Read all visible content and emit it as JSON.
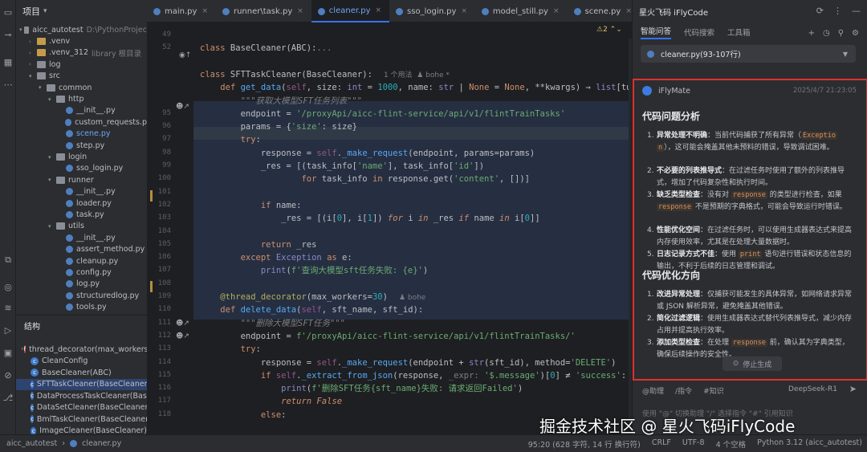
{
  "project": {
    "title": "项目",
    "tree": [
      {
        "label": "aicc_autotest",
        "sub": "D:\\PythonProjec",
        "depth": 0,
        "type": "folder",
        "open": true
      },
      {
        "label": ".venv",
        "depth": 1,
        "type": "folderY",
        "open": false
      },
      {
        "label": ".venv_312",
        "sub": "library 根目录",
        "depth": 1,
        "type": "folderY",
        "open": false
      },
      {
        "label": "log",
        "depth": 1,
        "type": "folder",
        "open": false
      },
      {
        "label": "src",
        "depth": 1,
        "type": "folder",
        "open": true
      },
      {
        "label": "common",
        "depth": 2,
        "type": "folder",
        "open": true
      },
      {
        "label": "http",
        "depth": 3,
        "type": "folder",
        "open": true
      },
      {
        "label": "__init__.py",
        "depth": 4,
        "type": "py"
      },
      {
        "label": "custom_requests.p",
        "depth": 4,
        "type": "py"
      },
      {
        "label": "scene.py",
        "depth": 4,
        "type": "py",
        "blue": true
      },
      {
        "label": "step.py",
        "depth": 4,
        "type": "py"
      },
      {
        "label": "login",
        "depth": 3,
        "type": "folder",
        "open": true
      },
      {
        "label": "sso_login.py",
        "depth": 4,
        "type": "py"
      },
      {
        "label": "runner",
        "depth": 3,
        "type": "folder",
        "open": true
      },
      {
        "label": "__init__.py",
        "depth": 4,
        "type": "py"
      },
      {
        "label": "loader.py",
        "depth": 4,
        "type": "py"
      },
      {
        "label": "task.py",
        "depth": 4,
        "type": "py"
      },
      {
        "label": "utils",
        "depth": 3,
        "type": "folder",
        "open": true
      },
      {
        "label": "__init__.py",
        "depth": 4,
        "type": "py"
      },
      {
        "label": "assert_method.py",
        "depth": 4,
        "type": "py"
      },
      {
        "label": "cleanup.py",
        "depth": 4,
        "type": "py"
      },
      {
        "label": "config.py",
        "depth": 4,
        "type": "py"
      },
      {
        "label": "log.py",
        "depth": 4,
        "type": "py"
      },
      {
        "label": "structuredlog.py",
        "depth": 4,
        "type": "py"
      },
      {
        "label": "tools.py",
        "depth": 4,
        "type": "py"
      }
    ]
  },
  "structure": {
    "title": "结构",
    "items": [
      {
        "label": "thread_decorator(max_workers",
        "kind": "red",
        "expand": true
      },
      {
        "label": "CleanConfig",
        "kind": "blue"
      },
      {
        "label": "BaseCleaner(ABC)",
        "kind": "blue"
      },
      {
        "label": "SFTTaskCleaner(BaseCleaner)",
        "kind": "blue",
        "selected": true
      },
      {
        "label": "DataProcessTaskCleaner(BaseC",
        "kind": "blue"
      },
      {
        "label": "DataSetCleaner(BaseCleaner)",
        "kind": "blue"
      },
      {
        "label": "BmlTaskCleaner(BaseCleaner)",
        "kind": "blue"
      },
      {
        "label": "ImageCleaner(BaseCleaner)",
        "kind": "blue"
      }
    ]
  },
  "tabs": [
    {
      "label": "main.py",
      "active": false
    },
    {
      "label": "runner\\task.py",
      "active": false
    },
    {
      "label": "cleaner.py",
      "active": true
    },
    {
      "label": "sso_login.py",
      "active": false
    },
    {
      "label": "model_still.py",
      "active": false
    },
    {
      "label": "scene.py",
      "active": false
    }
  ],
  "editor": {
    "warnings": "2",
    "lines": [
      {
        "n": "49",
        "html": ""
      },
      {
        "n": "52",
        "html": "<span class='kw'>class</span> BaseCleaner(ABC):<span style='color:#7a7e85'>...</span>"
      },
      {
        "n": "",
        "html": ""
      },
      {
        "n": "",
        "html": "<span class='kw'>class</span> SFTTaskCleaner(BaseCleaner):<span class='hint'>1 个用法  ♟ bohe *</span>"
      },
      {
        "n": "",
        "html": "    <span class='kw'>def</span> <span class='fn'>get_data</span>(<span class='self'>self</span>, size: <span class='builtin'>int</span> = <span class='num'>1000</span>, name: <span class='builtin'>str</span> | <span class='kw'>None</span> = <span class='kw'>None</span>, **kwargs) → <span class='builtin'>list</span>[tuple[Any"
      },
      {
        "n": "",
        "html": "        <span class='cmt'>\"\"\"获取大模型SFT任务列表\"\"\"</span>"
      },
      {
        "n": "95",
        "html": "        endpoint = <span class='str'>'/proxyApi/aicc-flint-service/api/v1/flintTrainTasks'</span>"
      },
      {
        "n": "96",
        "html": "        params = {<span class='str'>'size'</span>: size}"
      },
      {
        "n": "97",
        "html": "        <span class='kw'>try</span>:"
      },
      {
        "n": "98",
        "html": "            response = <span class='self'>self</span>.<span class='fn'>_make_request</span>(endpoint, params=params)"
      },
      {
        "n": "99",
        "html": "            _res = [(task_info[<span class='str'>'name'</span>], task_info[<span class='str'>'id'</span>])"
      },
      {
        "n": "100",
        "html": "                    <span class='kw'>for</span> task_info <span class='kw'>in</span> response.get(<span class='str'>'content'</span>, [])]"
      },
      {
        "n": "101",
        "html": ""
      },
      {
        "n": "102",
        "html": "            <span class='kw'>if</span> name:"
      },
      {
        "n": "103",
        "html": "                _res = [(i[<span class='num'>0</span>], i[<span class='num'>1</span>]) <span class='kw ital'>for</span> i <span class='kw ital'>in</span> _res <span class='kw ital'>if</span> name <span class='kw ital'>in</span> i[<span class='num'>0</span>]]"
      },
      {
        "n": "104",
        "html": ""
      },
      {
        "n": "105",
        "html": "            <span class='kw'>return</span> _res"
      },
      {
        "n": "106",
        "html": "        <span class='kw'>except</span> <span class='builtin'>Exception</span> <span class='kw'>as</span> e:"
      },
      {
        "n": "107",
        "html": "            <span class='builtin'>print</span>(<span class='str'>f'查询大模型sft任务失败: {e}'</span>)"
      },
      {
        "n": "108",
        "html": ""
      },
      {
        "n": "109",
        "html": "    <span class='dec'>@thread_decorator</span>(max_workers=<span class='num'>30</span>)<span class='hint'>♟ bohe</span>"
      },
      {
        "n": "110",
        "html": "    <span class='kw'>def</span> <span class='fn'>delete_data</span>(<span class='self'>self</span>, sft_name, sft_id):"
      },
      {
        "n": "111",
        "html": "        <span class='cmt'>\"\"\"删除大模型SFT任务\"\"\"</span>"
      },
      {
        "n": "112",
        "html": "        endpoint = <span class='str'>f'/proxyApi/aicc-flint-service/api/v1/flintTrainTasks/'</span>"
      },
      {
        "n": "113",
        "html": "        <span class='kw'>try</span>:"
      },
      {
        "n": "114",
        "html": "            response = <span class='self'>self</span>.<span class='fn'>_make_request</span>(endpoint + <span class='builtin'>str</span>(sft_id), method=<span class='str'>'DELETE'</span>)"
      },
      {
        "n": "115",
        "html": "            <span class='kw'>if</span> <span class='self'>self</span>.<span class='fn'>_extract_from_json</span>(response, <span style='color:#7a7e85'>_expr:</span> <span class='str'>'$.message'</span>)[<span class='num'>0</span>] ≠ <span class='str'>'success'</span>:"
      },
      {
        "n": "116",
        "html": "                <span class='builtin'>print</span>(<span class='str'>f'删除SFT任务{sft_name}失败: 请求返回Failed'</span>)"
      },
      {
        "n": "117",
        "html": "                <span class='kw ital'>return</span> <span class='kw ital'>False</span>"
      },
      {
        "n": "118",
        "html": "            <span class='kw'>else</span>:"
      }
    ]
  },
  "ai": {
    "title": "星火飞码 iFlyCode",
    "tabs": [
      "智能问答",
      "代码搜索",
      "工具箱"
    ],
    "context_file": "cleaner.py(93-107行)",
    "bot_name": "iFlyMate",
    "time": "2025/4/7 21:23:05",
    "section1": "代码问题分析",
    "items1": [
      {
        "b": "异常处理不明确",
        "t": "：当前代码捕获了所有异常（<span class='code-chip'>Exceptio</span><br><span class='code-chip'>n</span>），这可能会掩盖其他未预料的错误，导致调试困难。"
      },
      {
        "b": "不必要的列表推导式",
        "t": "：在过滤任务时使用了额外的列表推导式，增加了代码复杂性和执行时间。"
      },
      {
        "b": "缺乏类型检查",
        "t": "：没有对 <span class='code-chip'>response</span> 的类型进行检查，如果 <span class='code-chip'>response</span> 不是预期的字典格式，可能会导致运行时错误。"
      },
      {
        "b": "性能优化空间",
        "t": "：在过滤任务时，可以使用生成器表达式来提高内存使用效率，尤其是在处理大量数据时。"
      },
      {
        "b": "日志记录方式不佳",
        "t": "：使用 <span class='code-chip'>print</span> 语句进行错误和状态信息的输出，不利于后续的日志管理和调试。"
      }
    ],
    "section2": "代码优化方向",
    "items2": [
      {
        "b": "改进异常处理",
        "t": "：仅捕获可能发生的具体异常，如网络请求异常或 JSON 解析异常，避免掩盖其他错误。"
      },
      {
        "b": "简化过滤逻辑",
        "t": "：使用生成器表达式替代列表推导式，减少内存占用并提高执行效率。"
      },
      {
        "b": "添加类型检查",
        "t": "：在处理 <span class='code-chip'>response</span> 前，确认其为字典类型，确保后续操作的安全性。"
      }
    ],
    "stop_label": "停止生成",
    "input_tools": [
      "@助理",
      "/指令",
      "#知识"
    ],
    "model": "DeepSeek-R1",
    "input_placeholder": "使用 \"@\" 切换助理 \"/\" 选择指令 \"#\" 引用知识"
  },
  "status": {
    "crumb1": "aicc_autotest",
    "crumb2": "cleaner.py",
    "right": [
      "95:20 (628 字符, 14 行 换行符)",
      "CRLF",
      "UTF-8",
      "4 个空格",
      "Python 3.12 (aicc_autotest)"
    ]
  },
  "watermark": "掘金技术社区 @ 星火飞码iFlyCode"
}
